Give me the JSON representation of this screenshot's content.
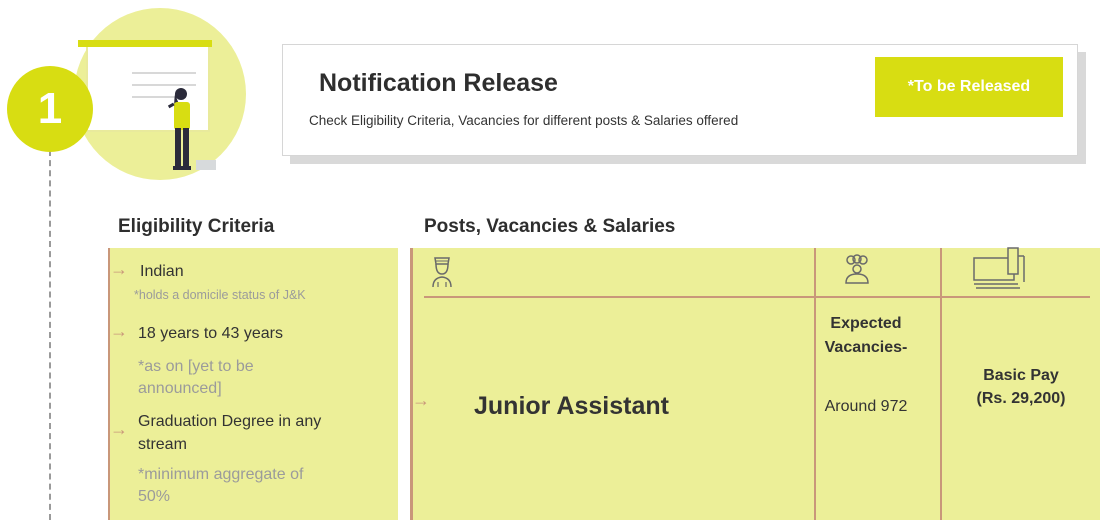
{
  "step": {
    "number": "1"
  },
  "notification": {
    "title": "Notification Release",
    "subtitle": "Check Eligibility Criteria, Vacancies for different posts & Salaries offered",
    "badge": "*To be Released"
  },
  "eligibility": {
    "heading": "Eligibility Criteria",
    "items": [
      {
        "main": "Indian",
        "note": "*holds a domicile status of J&K"
      },
      {
        "main": "18 years to 43 years",
        "note_lines": [
          "*as on [yet to be",
          "announced]"
        ]
      },
      {
        "main_lines": [
          "Graduation Degree in any",
          "stream"
        ],
        "note_lines": [
          "*minimum aggregate of",
          "50%"
        ]
      }
    ]
  },
  "posts": {
    "heading": "Posts, Vacancies & Salaries",
    "header_icons": [
      "officer-icon",
      "people-icon",
      "money-icon"
    ],
    "row": {
      "post": "Junior Assistant",
      "vacancies_label_lines": [
        "Expected",
        "Vacancies-"
      ],
      "vacancies_value": "Around 972",
      "pay_lines": [
        "Basic Pay",
        "(Rs. 29,200)"
      ]
    }
  },
  "colors": {
    "accent": "#d8dd12",
    "panel": "#ecef98",
    "line": "#c9977a",
    "text": "#333333",
    "note": "#9b9b9b"
  }
}
